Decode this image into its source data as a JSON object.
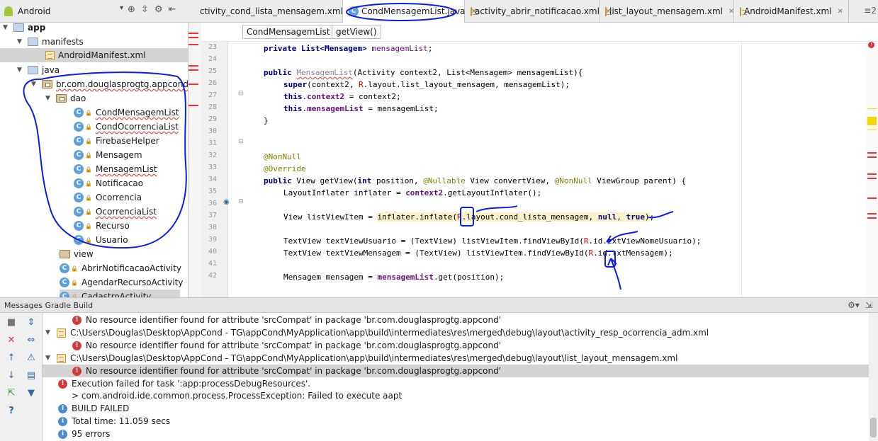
{
  "project_selector": {
    "label": "Android"
  },
  "tabs": [
    {
      "label": "ctivity_cond_lista_mensagem.xml",
      "icon": "xml-file-icon",
      "active": false
    },
    {
      "label": "CondMensagemList.java",
      "icon": "class-icon",
      "active": true
    },
    {
      "label": "activity_abrir_notificacao.xml",
      "icon": "xml-file-icon",
      "active": false
    },
    {
      "label": "list_layout_mensagem.xml",
      "icon": "xml-file-icon",
      "active": false
    },
    {
      "label": "AndroidManifest.xml",
      "icon": "xml-file-icon",
      "active": false
    }
  ],
  "tab_more": "≡2",
  "breadcrumbs": [
    "CondMensagemList",
    "getView()"
  ],
  "project_tree": [
    {
      "label": "app"
    },
    {
      "label": "manifests"
    },
    {
      "label": "AndroidManifest.xml"
    },
    {
      "label": "java"
    },
    {
      "label": "br.com.douglasprogtg.appcond"
    },
    {
      "label": "dao"
    },
    {
      "label": "CondMensagemList"
    },
    {
      "label": "CondOcorrenciaList"
    },
    {
      "label": "FirebaseHelper"
    },
    {
      "label": "Mensagem"
    },
    {
      "label": "MensagemList"
    },
    {
      "label": "Notificacao"
    },
    {
      "label": "Ocorrencia"
    },
    {
      "label": "OcorrenciaList"
    },
    {
      "label": "Recurso"
    },
    {
      "label": "Usuario"
    },
    {
      "label": "view"
    },
    {
      "label": "AbrirNotificacaoActivity"
    },
    {
      "label": "AgendarRecursoActivity"
    },
    {
      "label": "CadastroActivity"
    }
  ],
  "line_numbers": [
    "23",
    "24",
    "25",
    "26",
    "27",
    "28",
    "29",
    "30",
    "31",
    "32",
    "33",
    "34",
    "35",
    "36",
    "37",
    "38",
    "39",
    "40",
    "41",
    "42"
  ],
  "code": {
    "l23": [
      "private List<Mensagem> ",
      "mensagemList",
      ";"
    ],
    "l25": [
      "public ",
      "MensagemList",
      "(Activity context2, List<Mensagem> mensagemList){"
    ],
    "l26": [
      "super",
      "(context2, ",
      "R",
      ".layout.list_layout_mensagem, mensagemList);"
    ],
    "l27": [
      "this",
      ".",
      "context2",
      " = context2;"
    ],
    "l28": [
      "this",
      ".",
      "mensagemList",
      " = mensagemList;"
    ],
    "l29": [
      "}"
    ],
    "l32": [
      "@NonNull"
    ],
    "l33": [
      "@Override"
    ],
    "l34": [
      "public ",
      "View getView(",
      "int ",
      "position, ",
      "@Nullable ",
      "View convertView, ",
      "@NonNull ",
      "ViewGroup parent) {"
    ],
    "l35": [
      "LayoutInflater inflater = ",
      "context2",
      ".getLayoutInflater();"
    ],
    "l37": [
      "View listViewItem = ",
      "inflater.inflate(",
      "R",
      ".layout.cond_lista_mensagem, ",
      "null",
      ", ",
      "true",
      ")",
      ";"
    ],
    "l39": [
      "TextView textViewUsuario = (TextView) listViewItem.findViewById(",
      "R",
      ".id.txtViewNomeUsuario);"
    ],
    "l40": [
      "TextView textViewMensagem = (TextView) listViewItem.findViewById(",
      "R",
      ".id.txtMensagem);"
    ],
    "l42": [
      "Mensagem mensagem = ",
      "mensagemList",
      ".get(position);"
    ]
  },
  "messages_panel": {
    "title": "Messages Gradle Build",
    "rows": [
      {
        "type": "error",
        "text": "No resource identifier found for attribute 'srcCompat' in package 'br.com.douglasprogtg.appcond'"
      },
      {
        "type": "file",
        "text": "C:\\Users\\Douglas\\Desktop\\AppCond - TG\\appCond\\MyApplication\\app\\build\\intermediates\\res\\merged\\debug\\layout\\activity_resp_ocorrencia_adm.xml"
      },
      {
        "type": "error",
        "text": "No resource identifier found for attribute 'srcCompat' in package 'br.com.douglasprogtg.appcond'"
      },
      {
        "type": "file",
        "text": "C:\\Users\\Douglas\\Desktop\\AppCond - TG\\appCond\\MyApplication\\app\\build\\intermediates\\res\\merged\\debug\\layout\\list_layout_mensagem.xml"
      },
      {
        "type": "error",
        "text": "No resource identifier found for attribute 'srcCompat' in package 'br.com.douglasprogtg.appcond'",
        "selected": true
      },
      {
        "type": "error",
        "text": "Execution failed for task ':app:processDebugResources'."
      },
      {
        "type": "plain",
        "text": "> com.android.ide.common.process.ProcessException: Failed to execute aapt"
      },
      {
        "type": "info",
        "text": "BUILD FAILED"
      },
      {
        "type": "info",
        "text": "Total time: 11.059 secs"
      },
      {
        "type": "info",
        "text": "95 errors"
      }
    ]
  },
  "colors": {
    "accent_annotation": "#0a1ee6",
    "error": "#d23b3b",
    "selection": "#d4d4d4",
    "highlight": "#fbf2c9"
  }
}
